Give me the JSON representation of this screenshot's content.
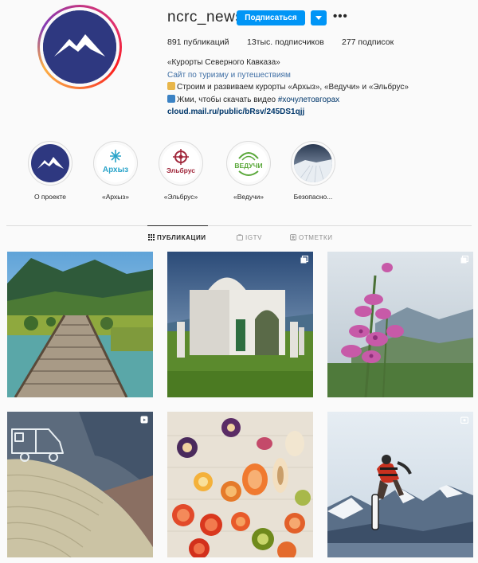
{
  "profile": {
    "username": "ncrc_news",
    "follow_label": "Подписаться",
    "stats": {
      "posts": "891 публикаций",
      "followers": "13тыс. подписчиков",
      "following": "277 подписок"
    },
    "bio": {
      "name": "«Курорты Северного Кавказа»",
      "category": "Сайт по туризму и путешествиям",
      "line1": "Строим и развиваем курорты «Архыз», «Ведучи» и «Эльбрус»",
      "line2_text": "Жми, чтобы скачать видео ",
      "line2_tag": "#хочулетовгорах",
      "link": "cloud.mail.ru/public/bRsv/245DS1qjj"
    }
  },
  "highlights": [
    {
      "label": "О проекте",
      "icon": "mountain-logo"
    },
    {
      "label": "«Архыз»",
      "icon": "arkhyz-logo"
    },
    {
      "label": "«Эльбрус»",
      "icon": "elbrus-logo"
    },
    {
      "label": "«Ведучи»",
      "icon": "veduchi-logo"
    },
    {
      "label": "Безопасно...",
      "icon": "snow-landscape"
    }
  ],
  "logos": {
    "arkhyz": "Архыз",
    "elbrus": "Эльбрус",
    "veduchi": "ВЕДУЧИ"
  },
  "tabs": [
    {
      "label": "ПУБЛИКАЦИИ",
      "icon": "grid-icon",
      "active": true
    },
    {
      "label": "IGTV",
      "icon": "igtv-icon",
      "active": false
    },
    {
      "label": "ОТМЕТКИ",
      "icon": "tagged-icon",
      "active": false
    }
  ],
  "posts": [
    {
      "subject": "wooden bridge over mountain river",
      "badge": "none"
    },
    {
      "subject": "white stone chapel in green meadow",
      "badge": "carousel-icon"
    },
    {
      "subject": "pink fireweed flowers on mountain slope",
      "badge": "carousel-icon"
    },
    {
      "subject": "knitted blanket with camper van drawing",
      "badge": "reel-icon"
    },
    {
      "subject": "dried fruit chips on wooden board",
      "badge": "none"
    },
    {
      "subject": "snowboarder jumping over snowy peaks",
      "badge": "igtv-icon"
    }
  ],
  "colors": {
    "accent": "#0095f6",
    "brand": "#2e3880",
    "link": "#00376b"
  }
}
